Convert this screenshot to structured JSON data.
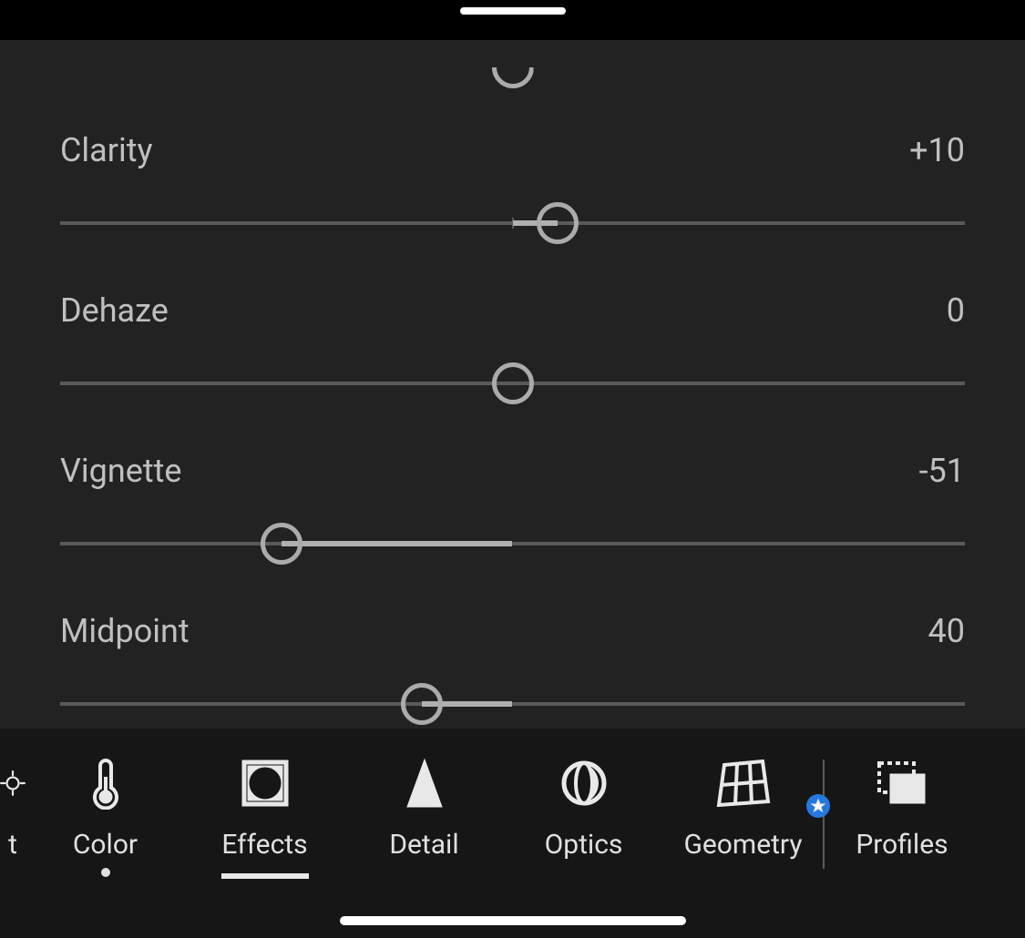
{
  "sliders": {
    "partial": {
      "value": 0,
      "min": -100,
      "max": 100
    },
    "clarity": {
      "label": "Clarity",
      "value": 10,
      "display": "+10",
      "min": -100,
      "max": 100
    },
    "dehaze": {
      "label": "Dehaze",
      "value": 0,
      "display": "0",
      "min": -100,
      "max": 100
    },
    "vignette": {
      "label": "Vignette",
      "value": -51,
      "display": "-51",
      "min": -100,
      "max": 100
    },
    "midpoint": {
      "label": "Midpoint",
      "value": 40,
      "display": "40",
      "min": 0,
      "max": 100,
      "default": 50
    }
  },
  "tabs": {
    "items": [
      {
        "key": "light",
        "label": "t",
        "partial": true
      },
      {
        "key": "color",
        "label": "Color",
        "modified": true
      },
      {
        "key": "effects",
        "label": "Effects",
        "active": true
      },
      {
        "key": "detail",
        "label": "Detail"
      },
      {
        "key": "optics",
        "label": "Optics"
      },
      {
        "key": "geometry",
        "label": "Geometry",
        "premium": true
      }
    ],
    "profiles": {
      "label": "Profiles"
    }
  }
}
